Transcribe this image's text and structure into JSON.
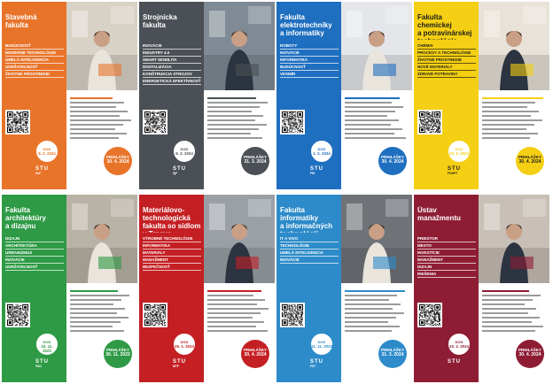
{
  "brand": "STU",
  "colors": {
    "fast": "#e8742a",
    "svf": "#4a5055",
    "fei": "#1f6fc0",
    "fchpt": "#f4cf14",
    "fad": "#2e9a45",
    "mtf": "#c42024",
    "fiit": "#2d8bc9",
    "ustm": "#8e1d34"
  },
  "panels": [
    {
      "key": "fast",
      "title": "Stavebná\nfakulta",
      "tags": [
        "BUDÚCNOSŤ",
        "MODERNÉ TECHNOLÓGIE",
        "UMELÁ INTELIGENCIA",
        "UDRŽATEĽNOSŤ",
        "ŽIVOTNÉ PROSTREDIE"
      ],
      "dod_label": "DOD",
      "dod_date": "8. 2. 2024",
      "prih_label": "PRIHLÁŠKY",
      "prih_date": "30. 4. 2024",
      "logo_sub": "SvF"
    },
    {
      "key": "svf",
      "title": "Strojnícka\nfakulta",
      "tags": [
        "INOVÁCIE",
        "INDUSTRY 4.0",
        "SMART MOBILITA",
        "DIGITALIZÁCIA",
        "KONŠTRUKCIA STROJOV",
        "ENERGETICKÁ EFEKTÍVNOSŤ"
      ],
      "dod_label": "DOD",
      "dod_date": "8. 2. 2024",
      "prih_label": "PRIHLÁŠKY",
      "prih_date": "31. 3. 2024",
      "logo_sub": "SjF"
    },
    {
      "key": "fei",
      "title": "Fakulta\nelektrotechniky\na informatiky",
      "tags": [
        "ROBOTY",
        "INOVÁCIE",
        "INFORMATIKA",
        "BUDÚCNOSŤ",
        "VESMÍR"
      ],
      "dod_label": "DOD",
      "dod_date": "1. 2. 2024",
      "prih_label": "PRIHLÁŠKY",
      "prih_date": "30. 4. 2024",
      "logo_sub": "FEI"
    },
    {
      "key": "fchpt",
      "title": "Fakulta\nchemickej\na potravinárskej\ntechnológie",
      "tags": [
        "CHÉMIA",
        "PROCESY A TECHNOLÓGIE",
        "ŽIVOTNÉ PROSTREDIE",
        "NOVÉ MATERIÁLY",
        "ZDRAVÉ POTRAVINY"
      ],
      "dod_label": "DOD",
      "dod_date": "10. 2. 2024",
      "prih_label": "PRIHLÁŠKY",
      "prih_date": "30. 4. 2024",
      "logo_sub": "FCHPT"
    },
    {
      "key": "fad",
      "title": "Fakulta\narchitektúry\na dizajnu",
      "tags": [
        "DIZAJN",
        "ARCHITEKTÚRA",
        "URBANIZMUS",
        "INOVÁCIE",
        "UDRŽATEĽNOSŤ"
      ],
      "dod_label": "DOD",
      "dod_date": "16. 11. 2023",
      "prih_label": "PRIHLÁŠKY",
      "prih_date": "30. 11. 2023",
      "logo_sub": "FAD"
    },
    {
      "key": "mtf",
      "title": "Materiálovo-\ntechnologická\nfakulta so sídlom\nv Trnave",
      "tags": [
        "VÝROBNÉ TECHNOLÓGIE",
        "INFORMATIKA",
        "MATERIÁLY",
        "MANAŽMENT",
        "BEZPEČNOSŤ"
      ],
      "dod_label": "DOD",
      "dod_date": "26. 1. 2024",
      "prih_label": "PRIHLÁŠKY",
      "prih_date": "30. 4. 2024",
      "logo_sub": "MTF"
    },
    {
      "key": "fiit",
      "title": "Fakulta\ninformatiky\na informačných\ntechnológií",
      "tags": [
        "IT A VIVO",
        "TECHNOLÓGIE",
        "UMELÁ INTELIGENCIA",
        "INOVÁCIE"
      ],
      "dod_label": "DOD",
      "dod_date": "11. 11. 2023",
      "prih_label": "PRIHLÁŠKY",
      "prih_date": "31. 3. 2024",
      "logo_sub": "FIIT"
    },
    {
      "key": "ustm",
      "title": "Ústav\nmanažmentu",
      "tags": [
        "PRIESTOR",
        "MESTO",
        "INVESTÍCIE",
        "MANAŽMENT",
        "DIZAJN",
        "RIEŠENIA"
      ],
      "dod_label": "DOD",
      "dod_date": "10. 2. 2024",
      "prih_label": "PRIHLÁŠKY",
      "prih_date": "30. 4. 2024",
      "logo_sub": ""
    }
  ]
}
